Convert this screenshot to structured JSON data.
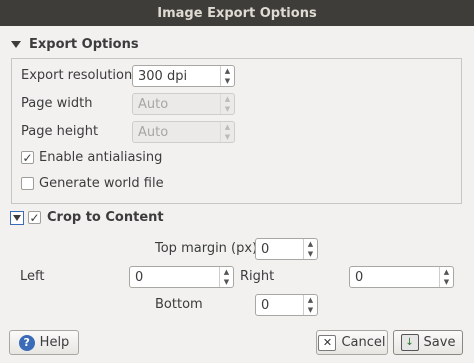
{
  "window": {
    "title": "Image Export Options"
  },
  "export_options": {
    "title": "Export Options",
    "resolution_label": "Export resolution",
    "resolution_value": "300 dpi",
    "page_width_label": "Page width",
    "page_width_value": "Auto",
    "page_height_label": "Page height",
    "page_height_value": "Auto",
    "antialiasing_label": "Enable antialiasing",
    "antialiasing_checked": true,
    "world_file_label": "Generate world file",
    "world_file_checked": false
  },
  "crop": {
    "title": "Crop to Content",
    "checked": true,
    "top_label": "Top margin (px)",
    "top_value": "0",
    "left_label": "Left",
    "left_value": "0",
    "right_label": "Right",
    "right_value": "0",
    "bottom_label": "Bottom",
    "bottom_value": "0"
  },
  "buttons": {
    "help": "Help",
    "cancel": "Cancel",
    "save": "Save"
  },
  "icons": {
    "check": "✓",
    "spin_up": "▲",
    "spin_down": "▼",
    "help": "?",
    "cancel": "✕",
    "save": "↓"
  }
}
